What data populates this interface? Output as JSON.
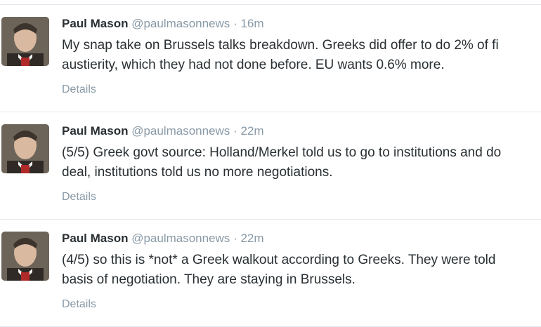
{
  "tweets": [
    {
      "name": "Paul Mason",
      "handle": "@paulmasonnews",
      "separator": "·",
      "time": "16m",
      "text": "My snap take on Brussels talks breakdown. Greeks did offer to do 2% of fi\naustierity, which they had not done before. EU wants 0.6% more.",
      "details": "Details"
    },
    {
      "name": "Paul Mason",
      "handle": "@paulmasonnews",
      "separator": "·",
      "time": "22m",
      "text": "(5/5) Greek govt source: Holland/Merkel told us to go to institutions and do\ndeal, institutions told us no more negotiations.",
      "details": "Details"
    },
    {
      "name": "Paul Mason",
      "handle": "@paulmasonnews",
      "separator": "·",
      "time": "22m",
      "text": "(4/5) so this is *not* a Greek walkout according to Greeks. They were told\nbasis of negotiation. They are staying in Brussels.",
      "details": "Details"
    }
  ]
}
